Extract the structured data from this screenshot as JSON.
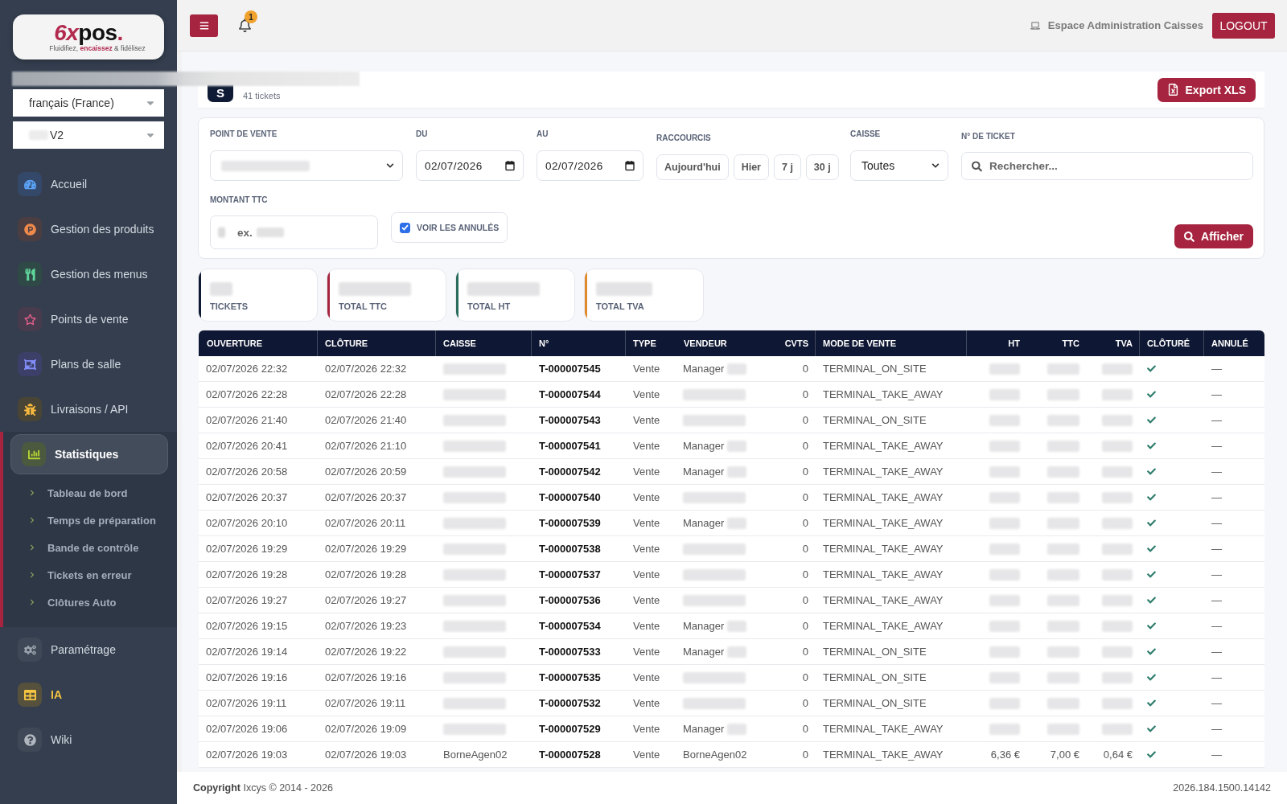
{
  "sidebar": {
    "logo": {
      "mark": "6x",
      "name": "pos",
      "dot": ".",
      "tagline": "Fluidifiez, **encaissez** & fidélisez"
    },
    "language": {
      "value": "français (France)"
    },
    "account": {
      "value": "V2"
    },
    "nav": [
      {
        "label": "Accueil",
        "selected": false,
        "highlighted": false
      },
      {
        "label": "Gestion des produits",
        "selected": false,
        "highlighted": false
      },
      {
        "label": "Gestion des menus",
        "selected": false,
        "highlighted": false
      },
      {
        "label": "Points de vente",
        "selected": false,
        "highlighted": false
      },
      {
        "label": "Plans de salle",
        "selected": false,
        "highlighted": false
      },
      {
        "label": "Livraisons / API",
        "selected": false,
        "highlighted": false
      },
      {
        "label": "Statistiques",
        "selected": true,
        "highlighted": false,
        "expanded": true,
        "children": [
          {
            "label": "Tableau de bord",
            "selected": false
          },
          {
            "label": "Temps de préparation",
            "selected": false
          },
          {
            "label": "Bande de contrôle",
            "selected": false
          },
          {
            "label": "Tickets en erreur",
            "selected": false
          },
          {
            "label": "Clôtures Auto",
            "selected": false
          }
        ]
      },
      {
        "label": "Paramétrage",
        "selected": false,
        "highlighted": false
      },
      {
        "label": "IA",
        "selected": false,
        "highlighted": true
      },
      {
        "label": "Wiki",
        "selected": false,
        "highlighted": false
      }
    ]
  },
  "topbar": {
    "notifications": "1",
    "space": "Espace Administration Caisses",
    "logout": "LOGOUT"
  },
  "header": {
    "initial": "S",
    "subtitle": "41 tickets",
    "export": "Export XLS"
  },
  "filters": {
    "store": {
      "label": "POINT DE VENTE"
    },
    "from": {
      "label": "DU",
      "value": "02/07/2026"
    },
    "to": {
      "label": "AU",
      "value": "02/07/2026"
    },
    "shortcuts": {
      "label": "RACCOURCIS",
      "buttons": [
        "Aujourd'hui",
        "Hier",
        "7 j",
        "30 j"
      ]
    },
    "register": {
      "label": "CAISSE",
      "value": "Toutes"
    },
    "ticket": {
      "label": "N° DE TICKET",
      "placeholder": "Rechercher..."
    },
    "amount": {
      "label": "MONTANT TTC",
      "placeholder": "ex."
    },
    "show_cancelled": {
      "label": "VOIR LES ANNULÉS",
      "checked": true
    },
    "submit": "Afficher"
  },
  "stats": [
    {
      "label": "TICKETS",
      "color": "#0f1a35"
    },
    {
      "label": "TOTAL TTC",
      "color": "#a6243f"
    },
    {
      "label": "TOTAL HT",
      "color": "#2a6b5e"
    },
    {
      "label": "TOTAL TVA",
      "color": "#e08a2b"
    }
  ],
  "table": {
    "columns": [
      {
        "label": "OUVERTURE"
      },
      {
        "label": "CLÔTURE"
      },
      {
        "label": "CAISSE"
      },
      {
        "label": "N°"
      },
      {
        "label": "TYPE"
      },
      {
        "label": "VENDEUR"
      },
      {
        "label": "CVTS"
      },
      {
        "label": "MODE DE VENTE"
      },
      {
        "label": "HT"
      },
      {
        "label": "TTC"
      },
      {
        "label": "TVA"
      },
      {
        "label": "CLÔTURÉ"
      },
      {
        "label": "ANNULÉ"
      }
    ],
    "rows": [
      {
        "ouverture": "02/07/2026 22:32",
        "cloture": "02/07/2026 22:32",
        "numero": "T-000007545",
        "type": "Vente",
        "vendeur": "Manager",
        "vendeur_partly_blurred": true,
        "cvts": "0",
        "mode": "TERMINAL_ON_SITE",
        "closed": true,
        "annule": "—"
      },
      {
        "ouverture": "02/07/2026 22:28",
        "cloture": "02/07/2026 22:28",
        "numero": "T-000007544",
        "type": "Vente",
        "cvts": "0",
        "mode": "TERMINAL_TAKE_AWAY",
        "closed": true,
        "annule": "—"
      },
      {
        "ouverture": "02/07/2026 21:40",
        "cloture": "02/07/2026 21:40",
        "numero": "T-000007543",
        "type": "Vente",
        "cvts": "0",
        "mode": "TERMINAL_ON_SITE",
        "closed": true,
        "annule": "—"
      },
      {
        "ouverture": "02/07/2026 20:41",
        "cloture": "02/07/2026 21:10",
        "numero": "T-000007541",
        "type": "Vente",
        "vendeur": "Manager",
        "vendeur_partly_blurred": true,
        "cvts": "0",
        "mode": "TERMINAL_TAKE_AWAY",
        "closed": true,
        "annule": "—"
      },
      {
        "ouverture": "02/07/2026 20:58",
        "cloture": "02/07/2026 20:59",
        "numero": "T-000007542",
        "type": "Vente",
        "vendeur": "Manager",
        "vendeur_partly_blurred": true,
        "cvts": "0",
        "mode": "TERMINAL_TAKE_AWAY",
        "closed": true,
        "annule": "—"
      },
      {
        "ouverture": "02/07/2026 20:37",
        "cloture": "02/07/2026 20:37",
        "numero": "T-000007540",
        "type": "Vente",
        "cvts": "0",
        "mode": "TERMINAL_TAKE_AWAY",
        "closed": true,
        "annule": "—"
      },
      {
        "ouverture": "02/07/2026 20:10",
        "cloture": "02/07/2026 20:11",
        "numero": "T-000007539",
        "type": "Vente",
        "vendeur": "Manager",
        "vendeur_partly_blurred": true,
        "cvts": "0",
        "mode": "TERMINAL_TAKE_AWAY",
        "closed": true,
        "annule": "—"
      },
      {
        "ouverture": "02/07/2026 19:29",
        "cloture": "02/07/2026 19:29",
        "numero": "T-000007538",
        "type": "Vente",
        "cvts": "0",
        "mode": "TERMINAL_TAKE_AWAY",
        "closed": true,
        "annule": "—"
      },
      {
        "ouverture": "02/07/2026 19:28",
        "cloture": "02/07/2026 19:28",
        "numero": "T-000007537",
        "type": "Vente",
        "cvts": "0",
        "mode": "TERMINAL_TAKE_AWAY",
        "closed": true,
        "annule": "—"
      },
      {
        "ouverture": "02/07/2026 19:27",
        "cloture": "02/07/2026 19:27",
        "numero": "T-000007536",
        "type": "Vente",
        "cvts": "0",
        "mode": "TERMINAL_TAKE_AWAY",
        "closed": true,
        "annule": "—"
      },
      {
        "ouverture": "02/07/2026 19:15",
        "cloture": "02/07/2026 19:23",
        "numero": "T-000007534",
        "type": "Vente",
        "vendeur": "Manager",
        "vendeur_partly_blurred": true,
        "cvts": "0",
        "mode": "TERMINAL_TAKE_AWAY",
        "closed": true,
        "annule": "—"
      },
      {
        "ouverture": "02/07/2026 19:14",
        "cloture": "02/07/2026 19:22",
        "numero": "T-000007533",
        "type": "Vente",
        "vendeur": "Manager",
        "vendeur_partly_blurred": true,
        "cvts": "0",
        "mode": "TERMINAL_ON_SITE",
        "closed": true,
        "annule": "—"
      },
      {
        "ouverture": "02/07/2026 19:16",
        "cloture": "02/07/2026 19:16",
        "numero": "T-000007535",
        "type": "Vente",
        "cvts": "0",
        "mode": "TERMINAL_ON_SITE",
        "closed": true,
        "annule": "—"
      },
      {
        "ouverture": "02/07/2026 19:11",
        "cloture": "02/07/2026 19:11",
        "numero": "T-000007532",
        "type": "Vente",
        "cvts": "0",
        "mode": "TERMINAL_ON_SITE",
        "closed": true,
        "annule": "—"
      },
      {
        "ouverture": "02/07/2026 19:06",
        "cloture": "02/07/2026 19:09",
        "numero": "T-000007529",
        "type": "Vente",
        "vendeur": "Manager",
        "vendeur_partly_blurred": true,
        "cvts": "0",
        "mode": "TERMINAL_TAKE_AWAY",
        "closed": true,
        "annule": "—"
      },
      {
        "ouverture": "02/07/2026 19:03",
        "cloture": "02/07/2026 19:03",
        "caisse": "BorneAgen02",
        "numero": "T-000007528",
        "type": "Vente",
        "vendeur": "BorneAgen02",
        "vendeur_partly_blurred": false,
        "cvts": "0",
        "mode": "TERMINAL_TAKE_AWAY",
        "ht": "6,36 €",
        "ttc": "7,00 €",
        "tva": "0,64 €",
        "closed": true,
        "annule": "—"
      }
    ]
  },
  "footer": {
    "copyright": "**Copyright** Ixcys © 2014 - 2026",
    "version": "2026.184.1500.14142"
  }
}
